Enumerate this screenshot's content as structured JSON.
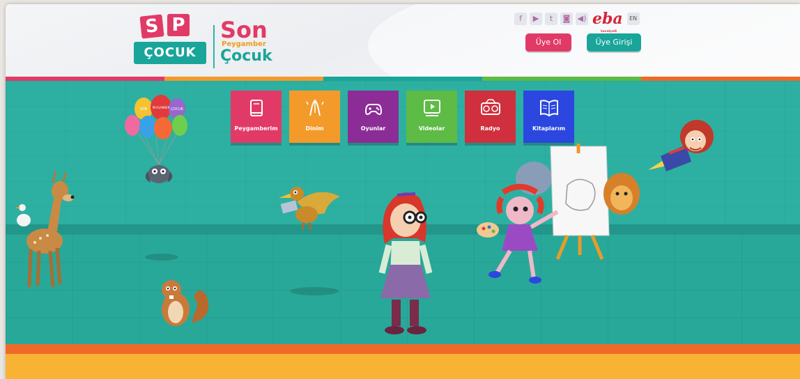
{
  "logo": {
    "block_s": "S",
    "block_p": "P",
    "cocuk": "ÇOCUK",
    "son": "Son",
    "peygamber": "Peygamber",
    "cocuk2": "Çocuk"
  },
  "header": {
    "socials": [
      "facebook-icon",
      "youtube-icon",
      "twitter-icon",
      "instagram-icon",
      "radio-icon"
    ],
    "eba": "eba",
    "eba_sub": "tavsiyeli",
    "lang": "EN",
    "register_label": "Üye Ol",
    "login_label": "Üye Girişi"
  },
  "colors": {
    "pink": "#e23a67",
    "teal": "#1aa59a",
    "orange": "#f09a20",
    "purple": "#8c2c96",
    "green": "#5dbb46",
    "red": "#d0303d",
    "blue": "#2b47e0"
  },
  "menu": [
    {
      "label": "Peygamberim",
      "icon": "book-icon",
      "color": "#e23a67"
    },
    {
      "label": "Dinim",
      "icon": "praying-hands-icon",
      "color": "#f39a2a"
    },
    {
      "label": "Oyunlar",
      "icon": "gamepad-icon",
      "color": "#8c2c96"
    },
    {
      "label": "Videolar",
      "icon": "video-play-icon",
      "color": "#5dbb46"
    },
    {
      "label": "Radyo",
      "icon": "radio-icon",
      "color": "#d0303d"
    },
    {
      "label": "Kitaplarım",
      "icon": "open-book-icon",
      "color": "#2b47e0"
    }
  ],
  "balloons": {
    "b1": "SON",
    "b2": "PEYGAMBER",
    "b3": "ÇOCUK"
  }
}
